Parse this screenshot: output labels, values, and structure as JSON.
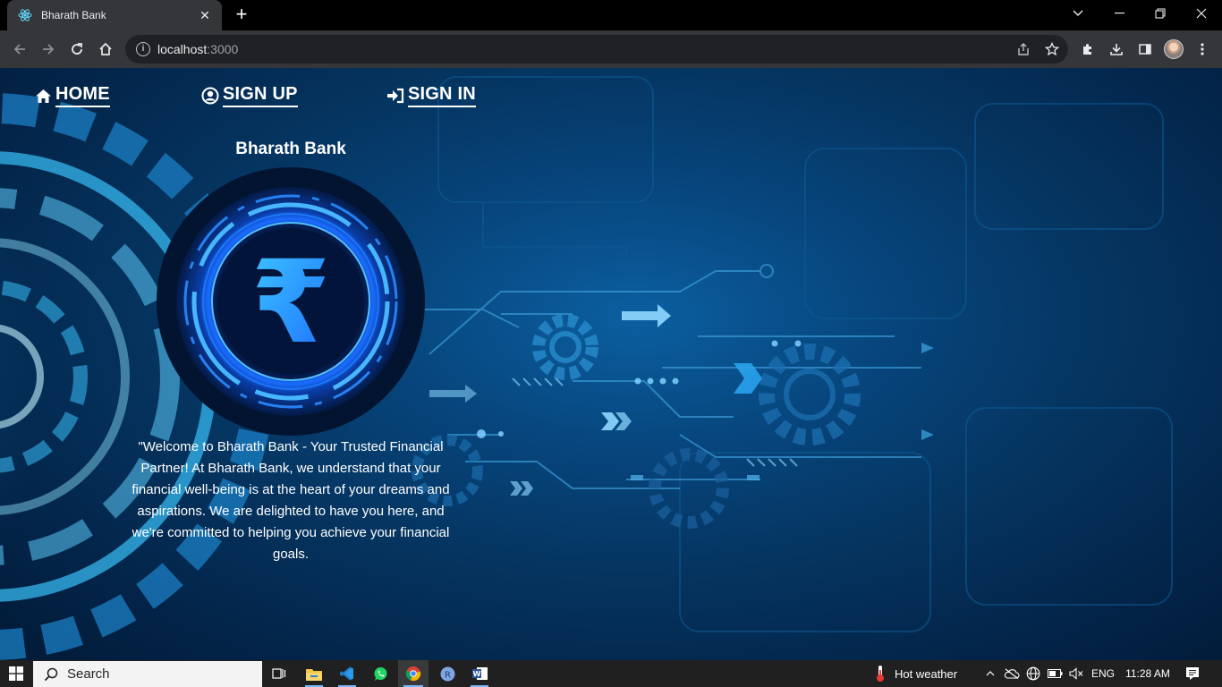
{
  "browser": {
    "tab_title": "Bharath Bank",
    "tab_close": "✕",
    "new_tab": "+",
    "url_host": "localhost",
    "url_port": ":3000",
    "window_controls": {
      "dropdown": "⌄",
      "minimize": "—",
      "restore": "❐",
      "close": "✕"
    }
  },
  "page": {
    "nav": {
      "home": "HOME",
      "signup": "SIGN UP",
      "signin": "SIGN IN"
    },
    "brand_name": "Bharath Bank",
    "logo_symbol": "₹",
    "welcome_text": "\"Welcome to Bharath Bank - Your Trusted Financial Partner! At Bharath Bank, we understand that your financial well-being is at the heart of your dreams and aspirations. We are delighted to have you here, and we're committed to helping you achieve your financial goals.",
    "colors": {
      "accent": "#1fa8ff",
      "background": "#053561",
      "text": "#ffffff"
    }
  },
  "taskbar": {
    "search_placeholder": "Search",
    "weather": "Hot weather",
    "language": "ENG",
    "time": "11:28 AM"
  }
}
